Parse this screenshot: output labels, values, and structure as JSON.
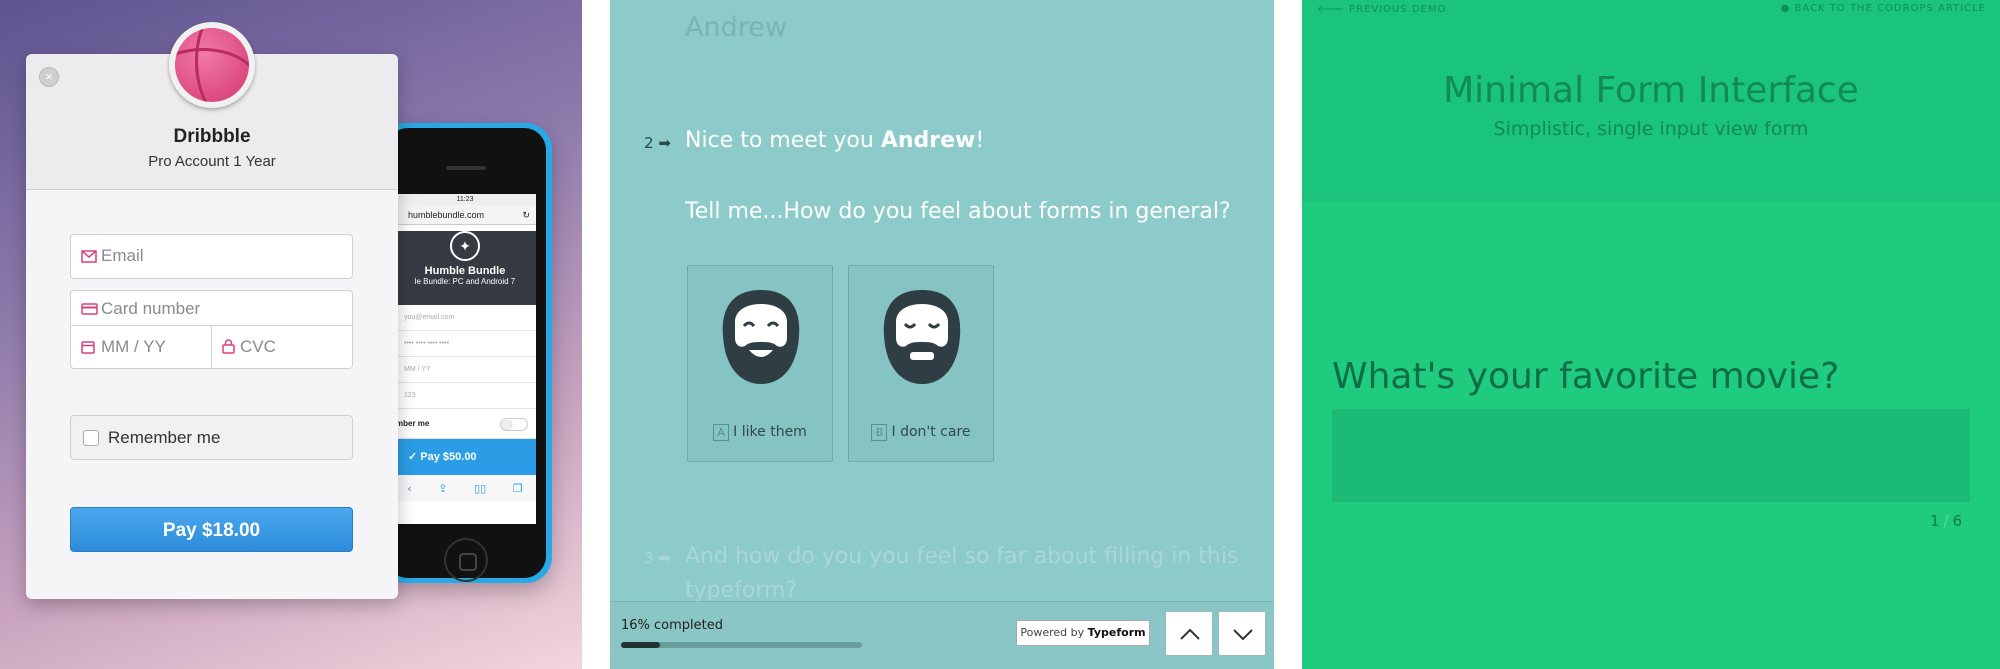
{
  "checkout": {
    "close_icon": "close-icon",
    "brand": "Dribbble",
    "subtitle": "Pro Account 1 Year",
    "email_placeholder": "Email",
    "card_placeholder": "Card number",
    "expiry_placeholder": "MM / YY",
    "cvc_placeholder": "CVC",
    "remember_label": "Remember me",
    "pay_label": "Pay $18.00",
    "accent_color": "#d9417b",
    "button_color": "#2b8bd8"
  },
  "phone": {
    "time": "11:23",
    "url": "humblebundle.com",
    "title": "Humble Bundle",
    "subtitle": "le Bundle: PC and Android 7",
    "email_placeholder": "you@email.com",
    "card_placeholder": "•••• •••• •••• ••••",
    "expiry_placeholder": "MM / YY",
    "cvc_placeholder": "123",
    "remember_label": "mber me",
    "pay_label": "Pay $50.00"
  },
  "typeform": {
    "prev_answer": "Andrew",
    "q2_number": "2",
    "q2_line1_pre": "Nice to meet you ",
    "q2_line1_name": "Andrew",
    "q2_line1_post": "!",
    "q2_line2": "Tell me...How do you feel about forms in general?",
    "choices": [
      {
        "key": "A",
        "label": "I like them"
      },
      {
        "key": "B",
        "label": "I don't care"
      }
    ],
    "q3_number": "3",
    "q3_text": "And how do you you feel so far about filling in this typeform?",
    "progress_text": "16% completed",
    "progress": 0.16,
    "powered_prefix": "Powered by ",
    "powered_brand": "Typeform",
    "background_color": "#8ccbca"
  },
  "minimal_form": {
    "prev_link": "PREVIOUS DEMO",
    "back_link": "BACK TO THE CODROPS ARTICLE",
    "title": "Minimal Form Interface",
    "subtitle": "Simplistic, single input view form",
    "question": "What's your favorite movie?",
    "current": "1",
    "separator": "/",
    "total": "6",
    "background_color": "#1fcb7e"
  }
}
